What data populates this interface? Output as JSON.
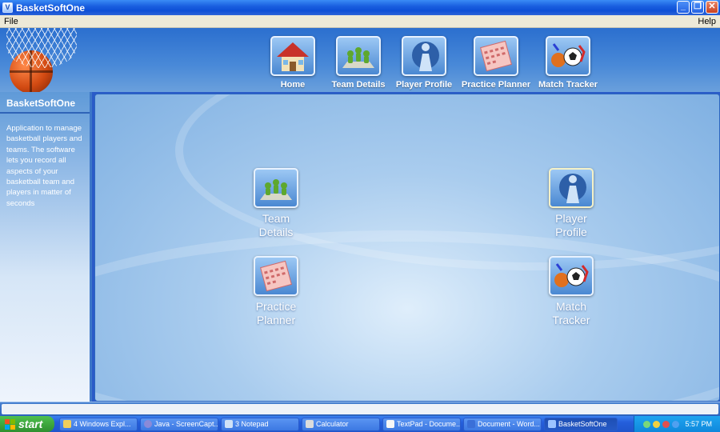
{
  "window": {
    "title": "BasketSoftOne",
    "app_icon": "V"
  },
  "menu": {
    "file": "File",
    "help": "Help"
  },
  "topnav": [
    {
      "label": "Home",
      "icon": "house-icon"
    },
    {
      "label": "Team Details",
      "icon": "team-figures-icon"
    },
    {
      "label": "Player Profile",
      "icon": "player-silhouette-icon"
    },
    {
      "label": "Practice Planner",
      "icon": "calendar-icon"
    },
    {
      "label": "Match Tracker",
      "icon": "soccer-ball-icon"
    }
  ],
  "sidebar": {
    "title": "BasketSoftOne",
    "description": "Application to manage basketball players and teams.  The software lets you record all aspects of your basketball team and players in matter of seconds"
  },
  "tiles": {
    "team_details": {
      "line1": "Team",
      "line2": "Details"
    },
    "player_profile": {
      "line1": "Player",
      "line2": "Profile"
    },
    "practice_planner": {
      "line1": "Practice",
      "line2": "Planner"
    },
    "match_tracker": {
      "line1": "Match",
      "line2": "Tracker"
    }
  },
  "taskbar": {
    "start": "start",
    "tasks": [
      "4 Windows Expl...",
      "Java - ScreenCapt...",
      "3 Notepad",
      "Calculator",
      "TextPad - Docume...",
      "Document - Word...",
      "BasketSoftOne"
    ],
    "clock": "5:57 PM"
  },
  "colors": {
    "accent": "#2b6fcf",
    "taskbar": "#245edb",
    "start": "#3fa63f"
  }
}
